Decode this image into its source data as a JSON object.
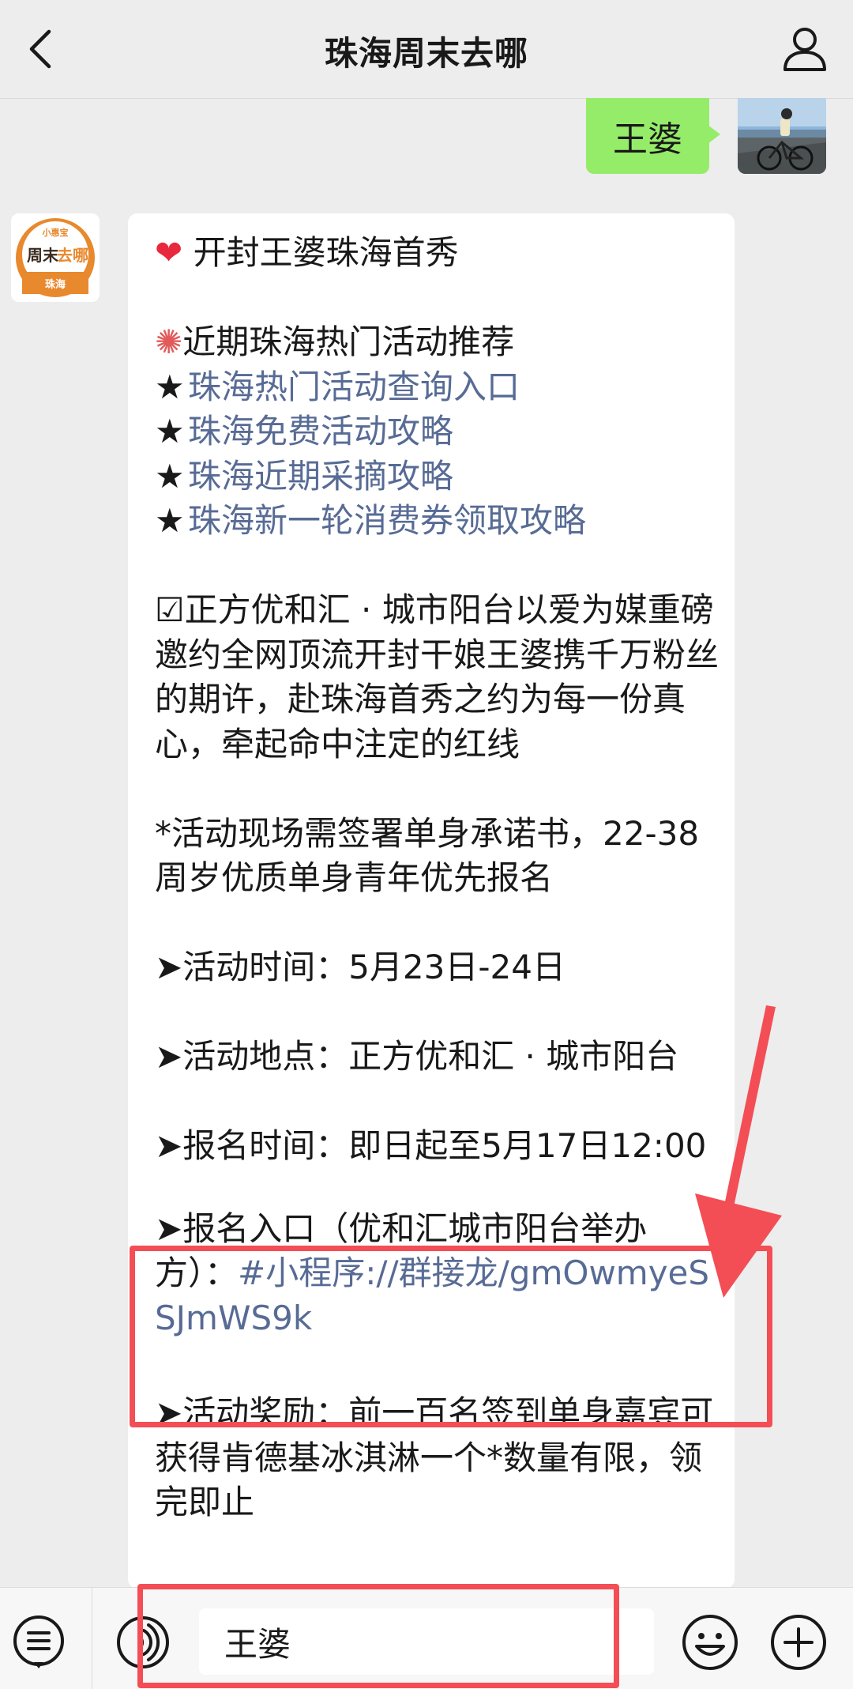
{
  "header": {
    "title": "珠海周末去哪"
  },
  "outgoing": {
    "text": "王婆"
  },
  "account_avatar": {
    "top_text": "小惠宝",
    "main_text_1": "周末",
    "main_text_2": "去哪",
    "bottom_text": "珠海"
  },
  "message": {
    "line_title_text": "开封王婆珠海首秀",
    "line_recommend": "近期珠海热门活动推荐",
    "links": [
      "珠海热门活动查询入口",
      "珠海免费活动攻略",
      "珠海近期采摘攻略",
      "珠海新一轮消费券领取攻略"
    ],
    "intro": "☑正方优和汇 · 城市阳台以爱为媒重磅邀约全网顶流开封干娘王婆携千万粉丝的期许，赴珠海首秀之约为每一份真心，牵起命中注定的红线",
    "notice": "*活动现场需签署单身承诺书，22-38周岁优质单身青年优先报名",
    "time": "➤活动时间：5月23日-24日",
    "place": "➤活动地点：正方优和汇 · 城市阳台",
    "signup_time": "➤报名时间：即日起至5月17日12:00",
    "entry_label": "➤报名入口（优和汇城市阳台举办方）：",
    "entry_link": "#小程序://群接龙/gmOwmyeSSJmWS9k",
    "reward": "➤活动奖励：前一百名签到单身嘉宾可获得肯德基冰淇淋一个*数量有限，领完即止"
  },
  "input": {
    "value": "王婆"
  },
  "colors": {
    "background": "#ededed",
    "bubble_out": "#95ec69",
    "link": "#576b95",
    "highlight": "#f34e55"
  },
  "icons": [
    "back-arrow-icon",
    "profile-icon",
    "menu-icon",
    "voice-icon",
    "emoji-icon",
    "plus-icon",
    "red-arrow"
  ]
}
